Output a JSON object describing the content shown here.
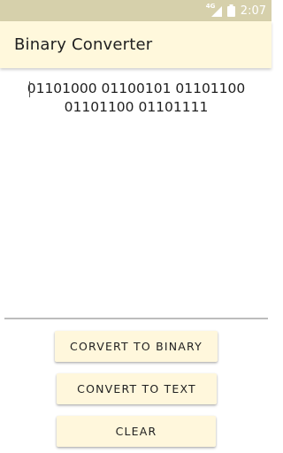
{
  "status_bar": {
    "network_label": "4G",
    "time": "2:07",
    "icons": [
      "signal-icon",
      "battery-icon"
    ]
  },
  "app_bar": {
    "title": "Binary Converter"
  },
  "output": {
    "text": "01101000 01100101 01101100 01101100 01101111"
  },
  "buttons": {
    "to_binary": "CORVERT TO BINARY",
    "to_text": "CONVERT TO TEXT",
    "clear": "CLEAR"
  },
  "colors": {
    "status_bar": "#d6d0ab",
    "app_bar": "#fff8dc",
    "button": "#fff7dc"
  }
}
